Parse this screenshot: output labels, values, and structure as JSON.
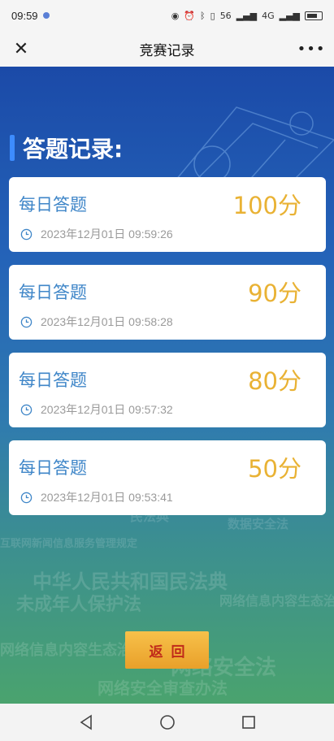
{
  "status_bar": {
    "time": "09:59",
    "network": "56",
    "signal": "4G"
  },
  "nav": {
    "title": "竞赛记录",
    "close_icon": "close-icon",
    "more_icon": "more-icon"
  },
  "section": {
    "title": "答题记录:"
  },
  "records": [
    {
      "name": "每日答题",
      "score": "100分",
      "time": "2023年12月01日 09:59:26"
    },
    {
      "name": "每日答题",
      "score": "90分",
      "time": "2023年12月01日 09:58:28"
    },
    {
      "name": "每日答题",
      "score": "80分",
      "time": "2023年12月01日 09:57:32"
    },
    {
      "name": "每日答题",
      "score": "50分",
      "time": "2023年12月01日 09:53:41"
    }
  ],
  "background_words": [
    "网络安全审查办法",
    "民法典",
    "中华人民共和国民法典",
    "未成年人保护法",
    "网络信息内容生态治理规定",
    "数据安全法",
    "互联网新闻信息服务管理规定",
    "网络安全法"
  ],
  "buttons": {
    "back": "返回"
  },
  "colors": {
    "accent_blue": "#3f86c8",
    "score_gold": "#e9b234",
    "button_gold": "#f0b23a",
    "button_text": "#c02a1a"
  }
}
